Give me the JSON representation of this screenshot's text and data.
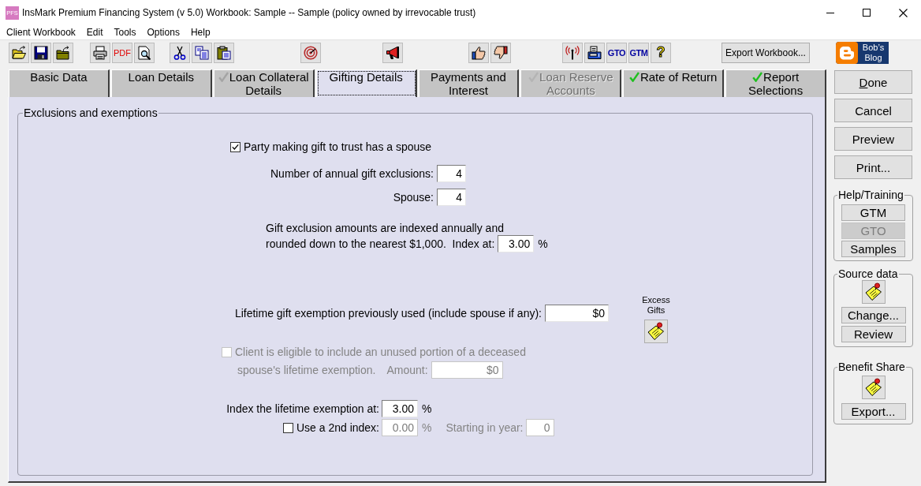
{
  "window": {
    "icon_text": "PFS",
    "title": "InsMark Premium Financing System (v 5.0) Workbook: Sample -- Sample (policy owned by irrevocable trust)"
  },
  "menu": [
    "Client Workbook",
    "Edit",
    "Tools",
    "Options",
    "Help"
  ],
  "toolbar": {
    "pdf": "PDF",
    "gto": "GTO",
    "gtm": "GTM",
    "help": "?",
    "export": "Export Workbook...",
    "blog": "Bob’s Blog"
  },
  "tabs": [
    {
      "label": "Basic Data",
      "selected": false,
      "checked": false,
      "disabled": false
    },
    {
      "label": "Loan Details",
      "selected": false,
      "checked": false,
      "disabled": false
    },
    {
      "label": "Loan Collateral Details",
      "selected": false,
      "checked": true,
      "color": "#a4a4a4",
      "disabled": false
    },
    {
      "label": "Gifting Details",
      "selected": true,
      "checked": false,
      "disabled": false
    },
    {
      "label": "Payments and Interest",
      "selected": false,
      "checked": false,
      "disabled": false
    },
    {
      "label": "Loan Reserve Accounts",
      "selected": false,
      "checked": true,
      "color": "#b4b4b4",
      "disabled": true
    },
    {
      "label": "Rate of Return",
      "selected": false,
      "checked": true,
      "color": "#1fbf1f",
      "disabled": false
    },
    {
      "label": "Report Selections",
      "selected": false,
      "checked": true,
      "color": "#1fbf1f",
      "disabled": false
    }
  ],
  "exclusions": {
    "legend": "Exclusions and exemptions",
    "has_spouse": {
      "label": "Party making gift to trust has a spouse",
      "checked": true
    },
    "annual_exclusions": {
      "label": "Number of annual gift exclusions:",
      "value": "4"
    },
    "spouse_exclusions": {
      "label": "Spouse:",
      "value": "4"
    },
    "indexing": {
      "line_1": "Gift exclusion amounts are indexed annually and",
      "line_2": "rounded down to the nearest $1,000.  Index at:",
      "value": "3.00",
      "unit": "%"
    },
    "lifetime_used": {
      "label": "Lifetime gift exemption previously used (include spouse if any):",
      "value": "$0"
    },
    "excess_gifts": {
      "label": "Excess Gifts"
    },
    "deceased_spouse": {
      "line_1": "Client is eligible to include an unused portion of a deceased",
      "line_2": "spouse's lifetime exemption.",
      "amount_label": "Amount:",
      "value": "$0",
      "checked": false,
      "disabled": true
    },
    "lifetime_index": {
      "label": "Index the lifetime exemption at:",
      "value": "3.00",
      "unit": "%"
    },
    "second_index": {
      "label": "Use a 2nd index:",
      "checked": false,
      "value": "0.00",
      "unit": "%",
      "start_label": "Starting in year:",
      "start_value": "0",
      "fields_disabled": true
    }
  },
  "side": {
    "buttons": [
      {
        "label": "Done",
        "underline_first": true
      },
      {
        "label": "Cancel",
        "underline_first": false
      },
      {
        "label": "Preview",
        "underline_first": false
      },
      {
        "label": "Print...",
        "underline_first": false
      }
    ],
    "help_training": {
      "title": "Help/Training",
      "buttons": [
        {
          "label": "GTM",
          "disabled": false
        },
        {
          "label": "GTO",
          "disabled": true
        },
        {
          "label": "Samples",
          "disabled": false
        }
      ]
    },
    "source_data": {
      "title": "Source data",
      "buttons": [
        {
          "label": "Change...",
          "disabled": false
        },
        {
          "label": "Review",
          "disabled": false
        }
      ]
    },
    "benefit_share": {
      "title": "Benefit Share",
      "buttons": [
        {
          "label": "Export...",
          "disabled": false
        }
      ]
    }
  }
}
